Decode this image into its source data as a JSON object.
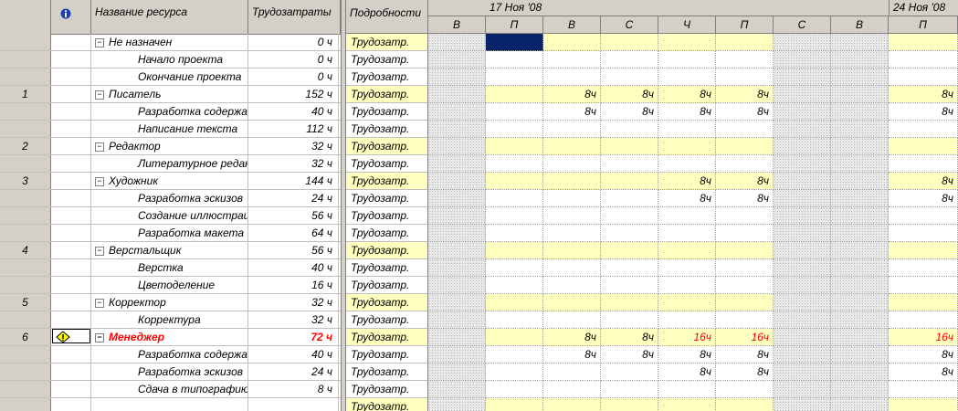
{
  "header": {
    "indicator_col": "",
    "name_col": "Название ресурса",
    "work_col": "Трудозатраты",
    "details_col": "Подробности"
  },
  "timescale": {
    "weeks": [
      "17 Ноя '08",
      "24 Ноя '08"
    ],
    "days": [
      "В",
      "П",
      "В",
      "С",
      "Ч",
      "П",
      "С",
      "В",
      "П"
    ]
  },
  "detail_label": "Трудозатр.",
  "rows": [
    {
      "id": "",
      "name": "Не назначен",
      "work": "0 ч",
      "group": true,
      "over": false,
      "values": [
        "",
        "",
        "",
        "",
        "",
        "",
        "",
        "",
        ""
      ]
    },
    {
      "id": "",
      "name": "Начало проекта",
      "work": "0 ч",
      "group": false,
      "over": false,
      "values": [
        "",
        "",
        "",
        "",
        "",
        "",
        "",
        "",
        ""
      ]
    },
    {
      "id": "",
      "name": "Окончание проекта",
      "work": "0 ч",
      "group": false,
      "over": false,
      "values": [
        "",
        "",
        "",
        "",
        "",
        "",
        "",
        "",
        ""
      ]
    },
    {
      "id": "1",
      "name": "Писатель",
      "work": "152 ч",
      "group": true,
      "over": false,
      "values": [
        "",
        "",
        "8ч",
        "8ч",
        "8ч",
        "8ч",
        "",
        "",
        "8ч"
      ]
    },
    {
      "id": "",
      "name": "Разработка содержания",
      "work": "40 ч",
      "group": false,
      "over": false,
      "values": [
        "",
        "",
        "8ч",
        "8ч",
        "8ч",
        "8ч",
        "",
        "",
        "8ч"
      ]
    },
    {
      "id": "",
      "name": "Написание текста",
      "work": "112 ч",
      "group": false,
      "over": false,
      "values": [
        "",
        "",
        "",
        "",
        "",
        "",
        "",
        "",
        ""
      ]
    },
    {
      "id": "2",
      "name": "Редактор",
      "work": "32 ч",
      "group": true,
      "over": false,
      "values": [
        "",
        "",
        "",
        "",
        "",
        "",
        "",
        "",
        ""
      ]
    },
    {
      "id": "",
      "name": "Литературное редактирование",
      "work": "32 ч",
      "group": false,
      "over": false,
      "values": [
        "",
        "",
        "",
        "",
        "",
        "",
        "",
        "",
        ""
      ]
    },
    {
      "id": "3",
      "name": "Художник",
      "work": "144 ч",
      "group": true,
      "over": false,
      "values": [
        "",
        "",
        "",
        "",
        "8ч",
        "8ч",
        "",
        "",
        "8ч"
      ]
    },
    {
      "id": "",
      "name": "Разработка эскизов",
      "work": "24 ч",
      "group": false,
      "over": false,
      "values": [
        "",
        "",
        "",
        "",
        "8ч",
        "8ч",
        "",
        "",
        "8ч"
      ]
    },
    {
      "id": "",
      "name": "Создание иллюстраций",
      "work": "56 ч",
      "group": false,
      "over": false,
      "values": [
        "",
        "",
        "",
        "",
        "",
        "",
        "",
        "",
        ""
      ]
    },
    {
      "id": "",
      "name": "Разработка макета",
      "work": "64 ч",
      "group": false,
      "over": false,
      "values": [
        "",
        "",
        "",
        "",
        "",
        "",
        "",
        "",
        ""
      ]
    },
    {
      "id": "4",
      "name": "Верстальщик",
      "work": "56 ч",
      "group": true,
      "over": false,
      "values": [
        "",
        "",
        "",
        "",
        "",
        "",
        "",
        "",
        ""
      ]
    },
    {
      "id": "",
      "name": "Верстка",
      "work": "40 ч",
      "group": false,
      "over": false,
      "values": [
        "",
        "",
        "",
        "",
        "",
        "",
        "",
        "",
        ""
      ]
    },
    {
      "id": "",
      "name": "Цветоделение",
      "work": "16 ч",
      "group": false,
      "over": false,
      "values": [
        "",
        "",
        "",
        "",
        "",
        "",
        "",
        "",
        ""
      ]
    },
    {
      "id": "5",
      "name": "Корректор",
      "work": "32 ч",
      "group": true,
      "over": false,
      "values": [
        "",
        "",
        "",
        "",
        "",
        "",
        "",
        "",
        ""
      ]
    },
    {
      "id": "",
      "name": "Корректура",
      "work": "32 ч",
      "group": false,
      "over": false,
      "values": [
        "",
        "",
        "",
        "",
        "",
        "",
        "",
        "",
        ""
      ]
    },
    {
      "id": "6",
      "name": "Менеджер",
      "work": "72 ч",
      "group": true,
      "over": true,
      "warn": true,
      "values": [
        "",
        "",
        "8ч",
        "8ч",
        "16ч",
        "16ч",
        "",
        "",
        "16ч"
      ],
      "red": [
        false,
        false,
        false,
        false,
        true,
        true,
        false,
        false,
        true
      ]
    },
    {
      "id": "",
      "name": "Разработка содержания",
      "work": "40 ч",
      "group": false,
      "over": false,
      "values": [
        "",
        "",
        "8ч",
        "8ч",
        "8ч",
        "8ч",
        "",
        "",
        "8ч"
      ]
    },
    {
      "id": "",
      "name": "Разработка эскизов",
      "work": "24 ч",
      "group": false,
      "over": false,
      "values": [
        "",
        "",
        "",
        "",
        "8ч",
        "8ч",
        "",
        "",
        "8ч"
      ]
    },
    {
      "id": "",
      "name": "Сдача в типографию",
      "work": "8 ч",
      "group": false,
      "over": false,
      "values": [
        "",
        "",
        "",
        "",
        "",
        "",
        "",
        "",
        ""
      ]
    },
    {
      "id": "",
      "name": "",
      "work": "",
      "group": true,
      "over": false,
      "values": [
        "",
        "",
        "",
        "",
        "",
        "",
        "",
        "",
        ""
      ]
    }
  ],
  "colors": {
    "header_bg": "#d4d0c8",
    "group_highlight": "#ffffc0",
    "overallocated": "#ff0000",
    "selection": "#0a246a"
  }
}
